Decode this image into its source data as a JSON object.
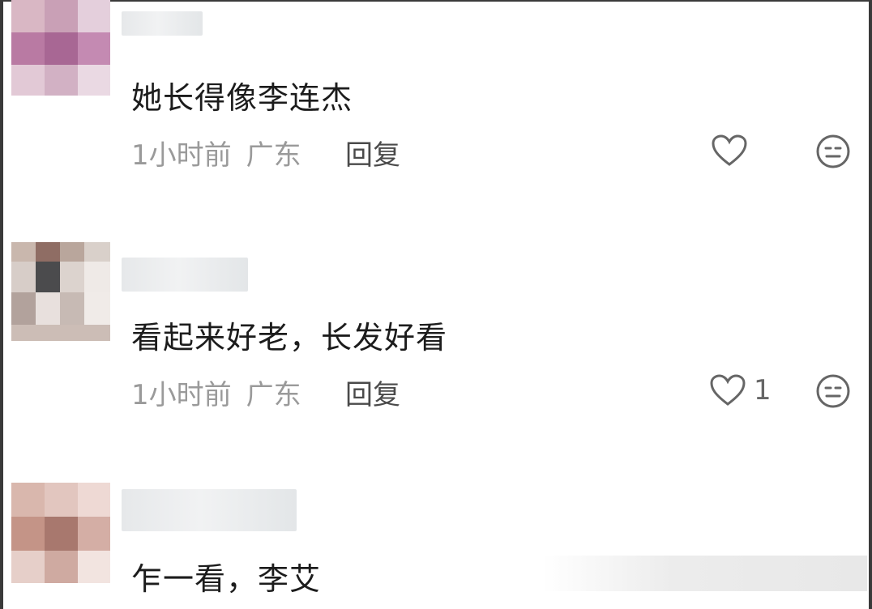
{
  "comments": [
    {
      "text": "她长得像李连杰",
      "time": "1小时前",
      "location": "广东",
      "reply_label": "回复",
      "like_count": "",
      "like_icon": "heart-outline-icon",
      "emoji_icon": "expressionless-face-icon"
    },
    {
      "text": "看起来好老，长发好看",
      "time": "1小时前",
      "location": "广东",
      "reply_label": "回复",
      "like_count": "1",
      "like_icon": "heart-outline-icon",
      "emoji_icon": "expressionless-face-icon"
    },
    {
      "text": "乍一看，李艾",
      "time": "",
      "location": "",
      "reply_label": "",
      "like_count": ""
    }
  ],
  "colors": {
    "text_primary": "#1c1c1c",
    "text_meta": "#9a9a9a",
    "icon_gray": "#666666",
    "frame": "#3a3a3a"
  }
}
